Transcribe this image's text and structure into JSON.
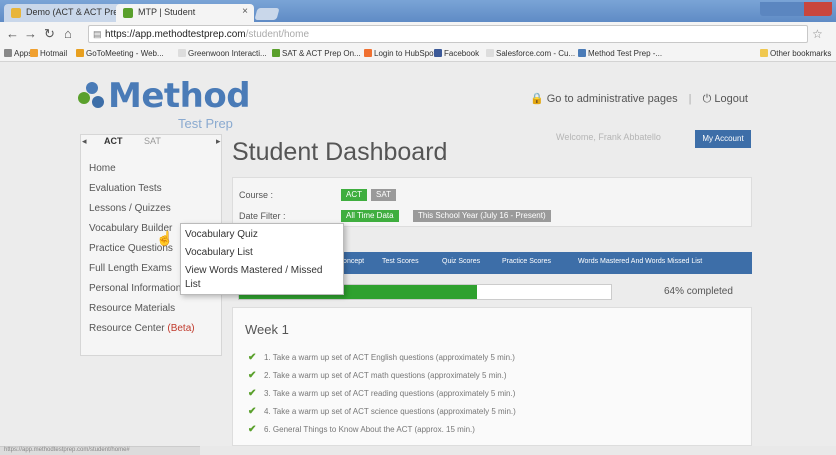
{
  "browser": {
    "tabs": [
      {
        "title": "Demo (ACT & ACT Prep) ×"
      },
      {
        "title": "MTP | Student"
      }
    ],
    "url_host": "https://app.methodtestprep.com",
    "url_path": "/student/home",
    "bookmarks": [
      "Apps",
      "Hotmail",
      "GoToMeeting - Web...",
      "Greenwoon Interacti...",
      "SAT & ACT Prep On...",
      "Login to HubSpot",
      "Facebook",
      "Salesforce.com - Cu...",
      "Method Test Prep -...",
      "Other bookmarks"
    ],
    "status_url": "https://app.methodtestprep.com/student/home#"
  },
  "header": {
    "logo_word": "Method",
    "logo_sub": "Test Prep",
    "admin_link": "Go to administrative pages",
    "separator": "|",
    "logout": "Logout"
  },
  "sidebar": {
    "tab_act": "ACT",
    "tab_sat": "SAT",
    "items": [
      {
        "label": "Home"
      },
      {
        "label": "Evaluation Tests"
      },
      {
        "label": "Lessons / Quizzes"
      },
      {
        "label": "Vocabulary Builder"
      },
      {
        "label": "Practice Questions"
      },
      {
        "label": "Full Length Exams"
      },
      {
        "label": "Personal Information"
      },
      {
        "label": "Resource Materials"
      },
      {
        "label": "Resource Center"
      }
    ],
    "beta": "(Beta)"
  },
  "vocab_menu": {
    "items": [
      "Vocabulary Quiz",
      "Vocabulary List",
      "View Words Mastered / Missed",
      "List"
    ]
  },
  "main": {
    "title": "Student Dashboard",
    "welcome": "Welcome, Frank Abbatello",
    "account_btn": "My Account",
    "course_label": "Course :",
    "course_options": [
      "ACT",
      "SAT"
    ],
    "date_label": "Date Filter :",
    "date_options": [
      "All Time Data",
      "This School Year (July 16 - Present)"
    ],
    "tabs": [
      "Concept",
      "Test Scores",
      "Quiz Scores",
      "Practice Scores",
      "Words Mastered And Words Missed List"
    ],
    "progress_percent": 64,
    "progress_text": "64% completed",
    "week": "Week 1",
    "tasks": [
      "1. Take a warm up set of ACT English questions (approximately 5 min.)",
      "2. Take a warm up set of ACT math questions (approximately 5 min.)",
      "3. Take a warm up set of ACT reading questions (approximately 5 min.)",
      "4. Take a warm up set of ACT science questions (approximately 5 min.)",
      "6. General Things to Know About the ACT (approx. 15 min.)"
    ]
  },
  "colors": {
    "brand_blue": "#4a7bb7",
    "nav_blue": "#3d6ea8",
    "progress_green": "#2fa12f",
    "chip_green": "#3fae3f",
    "chip_gray": "#9a9a9a"
  }
}
